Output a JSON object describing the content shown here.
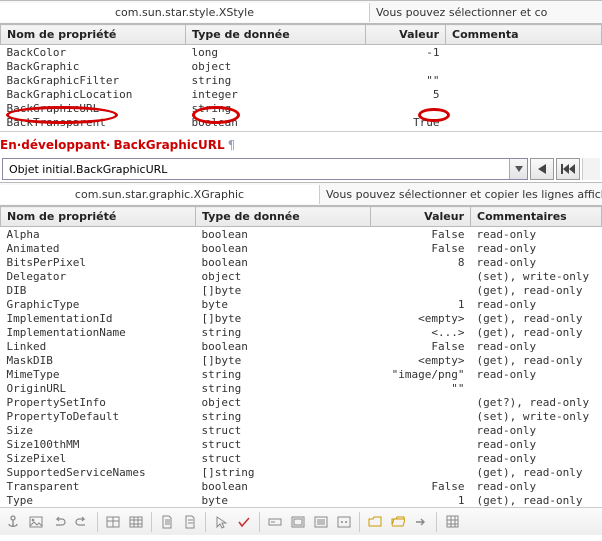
{
  "panel1": {
    "breadcrumb": "com.sun.star.style.XStyle",
    "hint": "Vous pouvez sélectionner et co",
    "headers": {
      "name": "Nom de propriété",
      "type": "Type de donnée",
      "value": "Valeur",
      "comment": "Commenta"
    },
    "rows": [
      {
        "name": "BackColor",
        "type": "long",
        "value": "-1",
        "comment": ""
      },
      {
        "name": "BackGraphic",
        "type": "object",
        "value": "",
        "comment": ""
      },
      {
        "name": "BackGraphicFilter",
        "type": "string",
        "value": "\"\"",
        "comment": ""
      },
      {
        "name": "BackGraphicLocation",
        "type": "integer",
        "value": "5",
        "comment": ""
      },
      {
        "name": "BackGraphicURL",
        "type": "string",
        "value": "",
        "comment": ""
      },
      {
        "name": "BackTransparent",
        "type": "boolean",
        "value": "True",
        "comment": ""
      }
    ]
  },
  "heading": {
    "prefix": "En·développant·",
    "bold": "BackGraphicURL",
    "pilcrow": "¶"
  },
  "combo": {
    "value": "Objet initial.BackGraphicURL"
  },
  "panel2": {
    "breadcrumb": "com.sun.star.graphic.XGraphic",
    "hint": "Vous pouvez sélectionner et copier les lignes affichée",
    "headers": {
      "name": "Nom de propriété",
      "type": "Type de donnée",
      "value": "Valeur",
      "comment": "Commentaires"
    },
    "rows": [
      {
        "name": "Alpha",
        "type": "boolean",
        "value": "False",
        "comment": "read-only"
      },
      {
        "name": "Animated",
        "type": "boolean",
        "value": "False",
        "comment": "read-only"
      },
      {
        "name": "BitsPerPixel",
        "type": "boolean",
        "value": "8",
        "comment": "read-only"
      },
      {
        "name": "Delegator",
        "type": "object",
        "value": "",
        "comment": "(set), write-only"
      },
      {
        "name": "DIB",
        "type": "[]byte",
        "value": "",
        "comment": "(get), read-only"
      },
      {
        "name": "GraphicType",
        "type": "byte",
        "value": "1",
        "comment": "read-only"
      },
      {
        "name": "ImplementationId",
        "type": "[]byte",
        "value": "<empty>",
        "comment": "(get), read-only"
      },
      {
        "name": "ImplementationName",
        "type": "string",
        "value": "<...>",
        "comment": "(get), read-only"
      },
      {
        "name": "Linked",
        "type": "boolean",
        "value": "False",
        "comment": "read-only"
      },
      {
        "name": "MaskDIB",
        "type": "[]byte",
        "value": "<empty>",
        "comment": "(get), read-only"
      },
      {
        "name": "MimeType",
        "type": "string",
        "value": "\"image/png\"",
        "comment": "read-only"
      },
      {
        "name": "OriginURL",
        "type": "string",
        "value": "\"\"",
        "comment": ""
      },
      {
        "name": "PropertySetInfo",
        "type": "object",
        "value": "",
        "comment": "(get?), read-only"
      },
      {
        "name": "PropertyToDefault",
        "type": "string",
        "value": "",
        "comment": "(set), write-only"
      },
      {
        "name": "Size",
        "type": "struct",
        "value": "",
        "comment": "read-only"
      },
      {
        "name": "Size100thMM",
        "type": "struct",
        "value": "",
        "comment": "read-only"
      },
      {
        "name": "SizePixel",
        "type": "struct",
        "value": "",
        "comment": "read-only"
      },
      {
        "name": "SupportedServiceNames",
        "type": "[]string",
        "value": "",
        "comment": "(get), read-only"
      },
      {
        "name": "Transparent",
        "type": "boolean",
        "value": "False",
        "comment": "read-only"
      },
      {
        "name": "Type",
        "type": "byte",
        "value": "1",
        "comment": "(get), read-only"
      }
    ]
  },
  "nav": {
    "back": "◄",
    "first": "▮◄◄"
  },
  "toolbar_icons": [
    "anchor",
    "image",
    "undo",
    "redo",
    "table",
    "table2",
    "doc",
    "arrow",
    "check",
    "formfield",
    "frame",
    "frame2",
    "props",
    "folder",
    "folder2",
    "arrowr",
    "grid"
  ]
}
